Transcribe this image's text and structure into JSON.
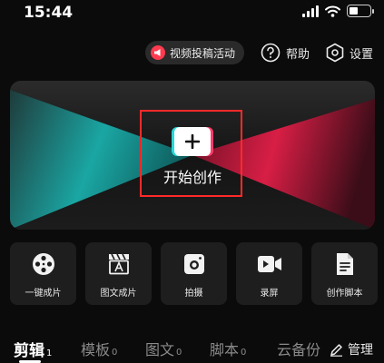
{
  "status_bar": {
    "time": "15:44"
  },
  "top_actions": {
    "promo_label": "视频投稿活动",
    "help_label": "帮助",
    "settings_label": "设置"
  },
  "banner": {
    "create_label": "开始创作"
  },
  "tools": [
    {
      "label": "一键成片",
      "icon": "film-reel-icon"
    },
    {
      "label": "图文成片",
      "icon": "text-clapboard-icon"
    },
    {
      "label": "拍摄",
      "icon": "camera-icon"
    },
    {
      "label": "录屏",
      "icon": "video-record-icon"
    },
    {
      "label": "创作脚本",
      "icon": "script-doc-icon"
    }
  ],
  "tabs": [
    {
      "label": "剪辑",
      "count": "1",
      "active": true
    },
    {
      "label": "模板",
      "count": "0"
    },
    {
      "label": "图文",
      "count": "0"
    },
    {
      "label": "脚本",
      "count": "0"
    },
    {
      "label": "云备份",
      "count": ""
    }
  ],
  "manage_label": "管理",
  "colors": {
    "accent_cyan": "#29d8d8",
    "accent_red": "#ff2a4a",
    "highlight_box": "#ff2a2a"
  }
}
